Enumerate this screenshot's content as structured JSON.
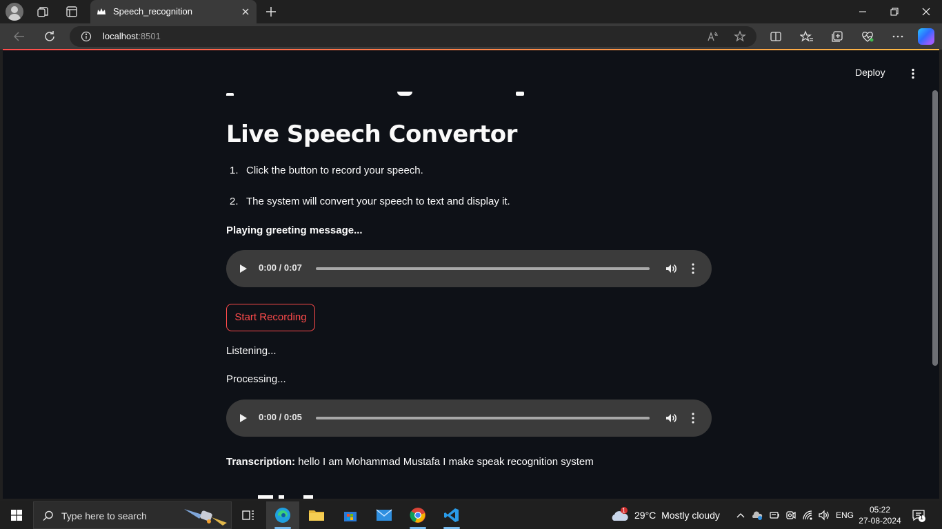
{
  "browser": {
    "tab_title": "Speech_recognition",
    "url_host": "localhost",
    "url_port": ":8501"
  },
  "app": {
    "deploy_label": "Deploy",
    "heading": "Live Speech Convertor",
    "steps": [
      {
        "num": "1.",
        "text": "Click the button to record your speech."
      },
      {
        "num": "2.",
        "text": "The system will convert your speech to text and display it."
      }
    ],
    "greeting_status": "Playing greeting message...",
    "audio_greeting": {
      "time": "0:00 / 0:07"
    },
    "record_button": "Start Recording",
    "listening_status": "Listening...",
    "processing_status": "Processing...",
    "audio_recording": {
      "time": "0:00 / 0:05"
    },
    "transcription_label": "Transcription:",
    "transcription_text": "hello I am Mohammad Mustafa I make speak recognition system"
  },
  "taskbar": {
    "search_placeholder": "Type here to search",
    "weather_temp": "29°C",
    "weather_desc": "Mostly cloudy",
    "weather_badge": "1",
    "language": "ENG",
    "time": "05:22",
    "date": "27-08-2024",
    "notification_count": "1"
  },
  "colors": {
    "accent": "#ff4b4b",
    "page_bg": "#0e1117",
    "text": "#fafafa"
  }
}
